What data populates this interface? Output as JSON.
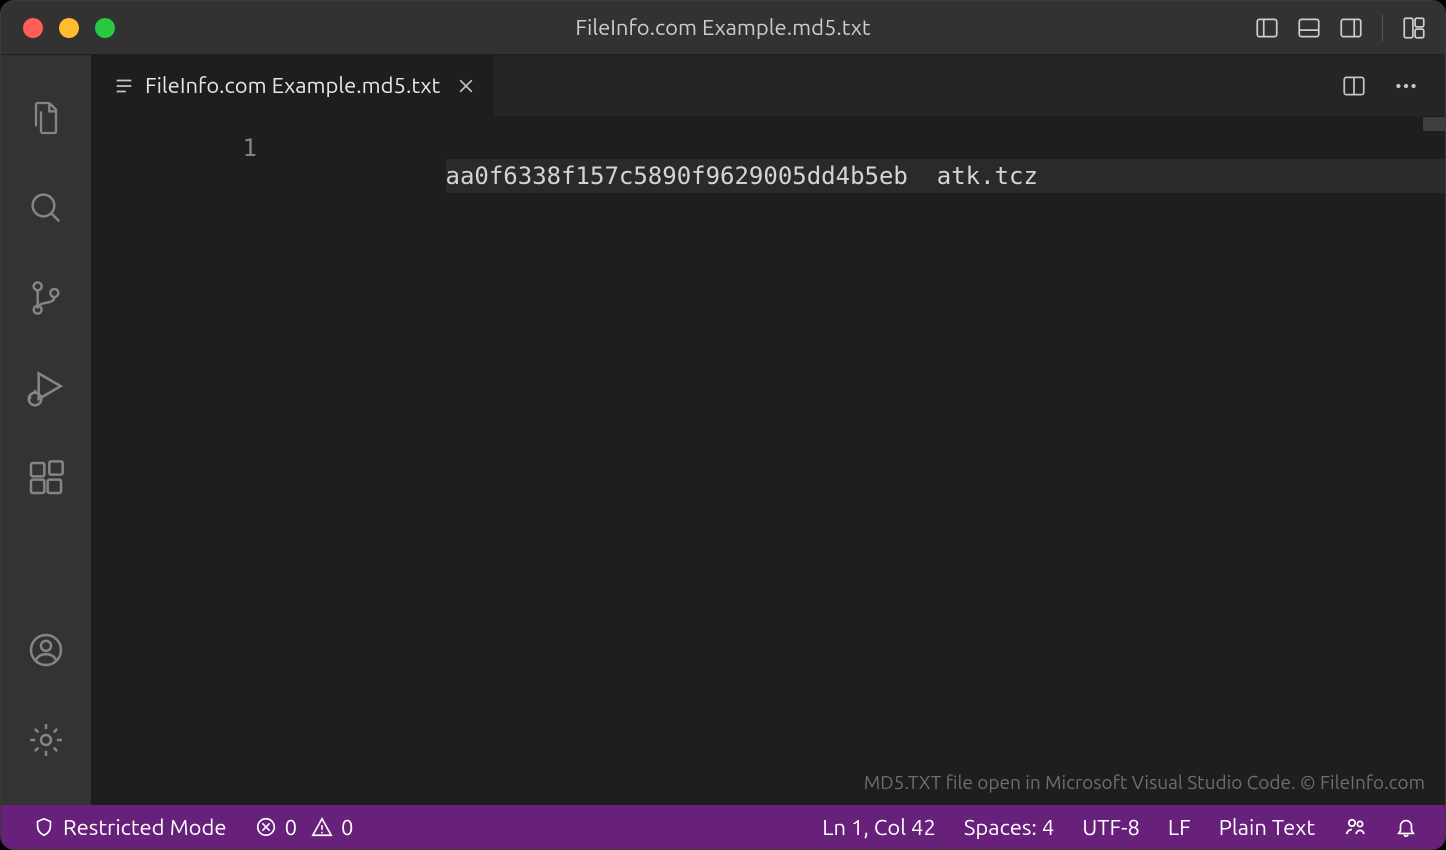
{
  "titlebar": {
    "title": "FileInfo.com Example.md5.txt"
  },
  "tab": {
    "label": "FileInfo.com Example.md5.txt"
  },
  "editor": {
    "line_number": "1",
    "line_content": "aa0f6338f157c5890f9629005dd4b5eb  atk.tcz"
  },
  "watermark": "MD5.TXT file open in Microsoft Visual Studio Code. © FileInfo.com",
  "statusbar": {
    "restricted": "Restricted Mode",
    "errors": "0",
    "warnings": "0",
    "cursor": "Ln 1, Col 42",
    "spaces": "Spaces: 4",
    "encoding": "UTF-8",
    "eol": "LF",
    "language": "Plain Text"
  }
}
